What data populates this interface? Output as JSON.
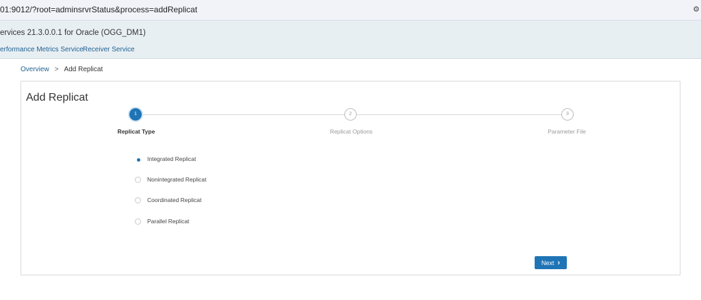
{
  "browser": {
    "url": "01:9012/?root=adminsrvrStatus&process=addReplicat",
    "settings_icon": "gear-icon"
  },
  "header": {
    "title": "ervices 21.3.0.0.1 for Oracle (OGG_DM1)",
    "nav": [
      {
        "label": "erformance Metrics Service"
      },
      {
        "label": "Receiver Service"
      }
    ]
  },
  "breadcrumb": {
    "root": "Overview",
    "separator": ">",
    "current": "Add Replicat"
  },
  "wizard": {
    "title": "Add Replicat",
    "steps": [
      {
        "number": "1",
        "label": "Replicat Type",
        "active": true
      },
      {
        "number": "2",
        "label": "Replicat Options",
        "active": false
      },
      {
        "number": "3",
        "label": "Parameter File",
        "active": false
      }
    ],
    "options": [
      {
        "label": "Integrated Replicat",
        "selected": true
      },
      {
        "label": "Nonintegrated Replicat",
        "selected": false
      },
      {
        "label": "Coordinated Replicat",
        "selected": false
      },
      {
        "label": "Parallel Replicat",
        "selected": false
      }
    ],
    "next_label": "Next",
    "next_icon": "chevron-right-icon"
  }
}
